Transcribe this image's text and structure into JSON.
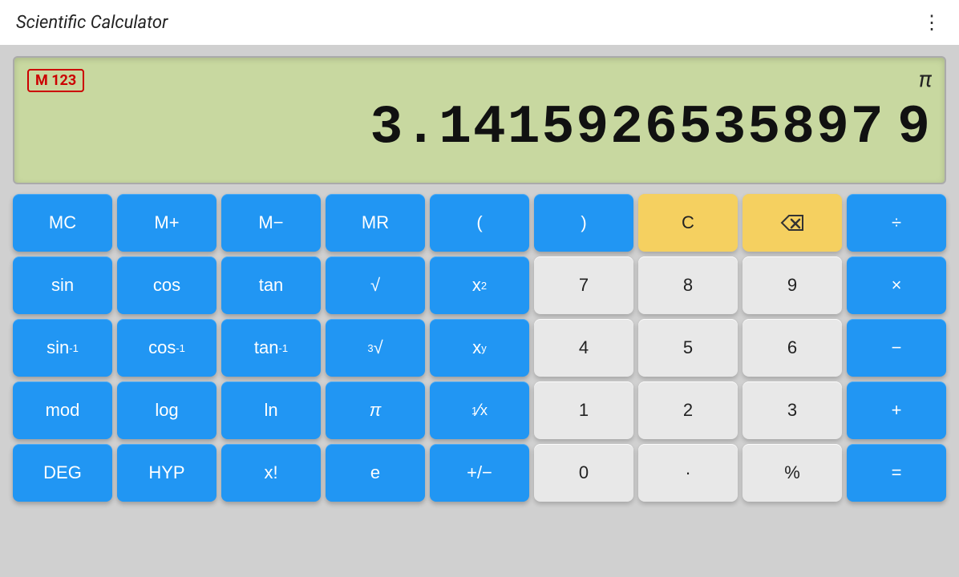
{
  "titleBar": {
    "title": "Scientific Calculator",
    "moreIcon": "⋮"
  },
  "display": {
    "piSymbol": "π",
    "memoryBadge": "M 123",
    "value": "3.1415926535897 9"
  },
  "buttons": {
    "row1": [
      {
        "label": "MC",
        "type": "blue",
        "name": "mc-button"
      },
      {
        "label": "M+",
        "type": "blue",
        "name": "m-plus-button"
      },
      {
        "label": "M−",
        "type": "blue",
        "name": "m-minus-button"
      },
      {
        "label": "MR",
        "type": "blue",
        "name": "mr-button"
      },
      {
        "label": "(",
        "type": "blue",
        "name": "open-paren-button"
      },
      {
        "label": ")",
        "type": "blue",
        "name": "close-paren-button"
      },
      {
        "label": "C",
        "type": "yellow",
        "name": "clear-button"
      },
      {
        "label": "⌫",
        "type": "yellow",
        "name": "backspace-button"
      },
      {
        "label": "÷",
        "type": "blue",
        "name": "divide-button"
      }
    ],
    "row2": [
      {
        "label": "sin",
        "type": "blue",
        "name": "sin-button"
      },
      {
        "label": "cos",
        "type": "blue",
        "name": "cos-button"
      },
      {
        "label": "tan",
        "type": "blue",
        "name": "tan-button"
      },
      {
        "label": "√",
        "type": "blue",
        "name": "sqrt-button"
      },
      {
        "label": "x²",
        "type": "blue",
        "name": "square-button"
      },
      {
        "label": "7",
        "type": "gray",
        "name": "seven-button"
      },
      {
        "label": "8",
        "type": "gray",
        "name": "eight-button"
      },
      {
        "label": "9",
        "type": "gray",
        "name": "nine-button"
      },
      {
        "label": "×",
        "type": "blue",
        "name": "multiply-button"
      }
    ],
    "row3": [
      {
        "label": "sin⁻¹",
        "type": "blue",
        "name": "asin-button"
      },
      {
        "label": "cos⁻¹",
        "type": "blue",
        "name": "acos-button"
      },
      {
        "label": "tan⁻¹",
        "type": "blue",
        "name": "atan-button"
      },
      {
        "label": "³√",
        "type": "blue",
        "name": "cbrt-button"
      },
      {
        "label": "xʸ",
        "type": "blue",
        "name": "power-button"
      },
      {
        "label": "4",
        "type": "gray",
        "name": "four-button"
      },
      {
        "label": "5",
        "type": "gray",
        "name": "five-button"
      },
      {
        "label": "6",
        "type": "gray",
        "name": "six-button"
      },
      {
        "label": "−",
        "type": "blue",
        "name": "subtract-button"
      }
    ],
    "row4": [
      {
        "label": "mod",
        "type": "blue",
        "name": "mod-button"
      },
      {
        "label": "log",
        "type": "blue",
        "name": "log-button"
      },
      {
        "label": "ln",
        "type": "blue",
        "name": "ln-button"
      },
      {
        "label": "π",
        "type": "blue",
        "name": "pi-button"
      },
      {
        "label": "¹⁄ₓ",
        "type": "blue",
        "name": "reciprocal-button"
      },
      {
        "label": "1",
        "type": "gray",
        "name": "one-button"
      },
      {
        "label": "2",
        "type": "gray",
        "name": "two-button"
      },
      {
        "label": "3",
        "type": "gray",
        "name": "three-button"
      },
      {
        "label": "+",
        "type": "blue",
        "name": "add-button"
      }
    ],
    "row5": [
      {
        "label": "DEG",
        "type": "blue",
        "name": "deg-button"
      },
      {
        "label": "HYP",
        "type": "blue",
        "name": "hyp-button"
      },
      {
        "label": "x!",
        "type": "blue",
        "name": "factorial-button"
      },
      {
        "label": "e",
        "type": "blue",
        "name": "euler-button"
      },
      {
        "label": "+/−",
        "type": "blue",
        "name": "negate-button"
      },
      {
        "label": "0",
        "type": "gray",
        "name": "zero-button"
      },
      {
        "label": "·",
        "type": "gray",
        "name": "decimal-button"
      },
      {
        "label": "%",
        "type": "gray",
        "name": "percent-button"
      },
      {
        "label": "=",
        "type": "blue",
        "name": "equals-button"
      }
    ]
  }
}
